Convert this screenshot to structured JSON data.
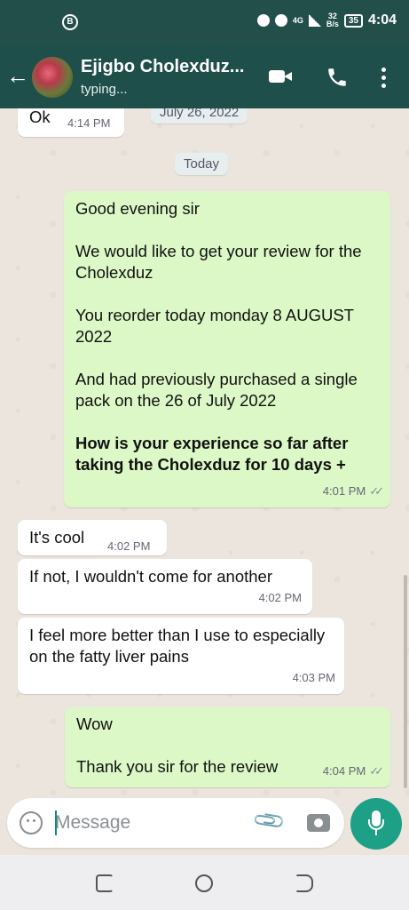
{
  "status_bar": {
    "network": "4G",
    "speed_value": "32",
    "speed_unit": "B/s",
    "battery": "35",
    "clock": "4:04"
  },
  "header": {
    "contact_name": "Ejigbo Cholexduz...",
    "status": "typing..."
  },
  "chat": {
    "date_old": "July 26, 2022",
    "date_today": "Today",
    "messages": [
      {
        "dir": "in",
        "text": "Ok",
        "time": "4:14 PM"
      },
      {
        "dir": "out",
        "paragraphs": [
          "Good evening sir",
          "We would like to get your review for the Cholexduz",
          "You reorder today monday 8 AUGUST 2022",
          "And had previously purchased a single pack on the 26 of July 2022",
          "How is your experience so far after taking the Cholexduz for 10 days +"
        ],
        "time": "4:01 PM"
      },
      {
        "dir": "in",
        "text": "It's cool",
        "time": "4:02 PM"
      },
      {
        "dir": "in",
        "text": "If not, I wouldn't come for another",
        "time": "4:02 PM"
      },
      {
        "dir": "in",
        "text": "I feel more better than I use to especially on the fatty liver pains",
        "time": "4:03 PM"
      },
      {
        "dir": "out",
        "paragraphs": [
          "Wow",
          "Thank you sir for the review"
        ],
        "time": "4:04 PM"
      }
    ]
  },
  "composer": {
    "placeholder": "Message"
  },
  "icons": {
    "back": "arrow-left-icon",
    "video": "video-call-icon",
    "call": "phone-icon",
    "menu": "more-vert-icon",
    "emoji": "emoji-icon",
    "attach": "paperclip-icon",
    "camera": "camera-icon",
    "mic": "mic-icon"
  },
  "colors": {
    "header": "#1f4f4a",
    "outgoing_bubble": "#dcf8c6",
    "incoming_bubble": "#ffffff",
    "accent": "#1da085",
    "chat_background": "#ece5dd"
  }
}
